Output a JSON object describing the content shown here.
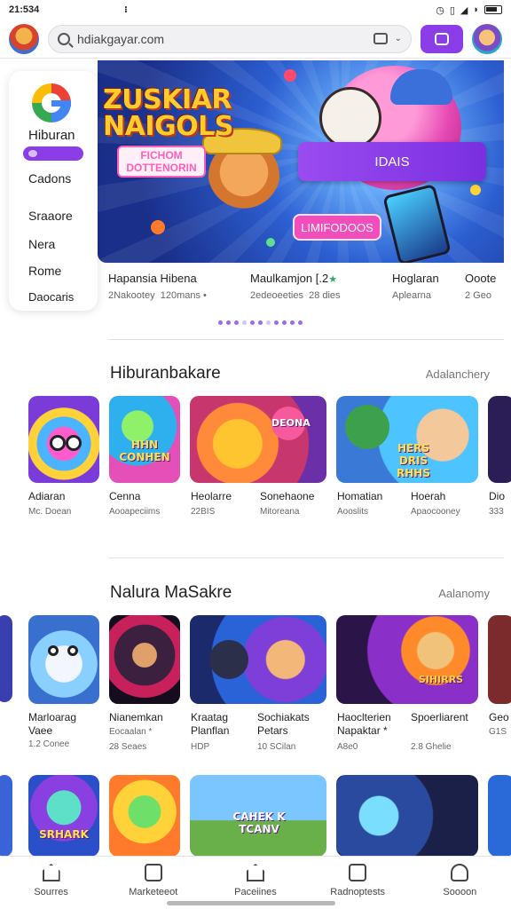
{
  "status_bar": {
    "time": "21:534",
    "mid": "⁝",
    "icons": [
      "alarm-icon",
      "vibrate-icon",
      "signal-icon",
      "wifi-icon",
      "battery-icon"
    ]
  },
  "top_bar": {
    "search_value": "hdiakgayar.com",
    "search_icon": "search-icon",
    "tab_icon": "tab-switcher-icon",
    "menu_chevron": "⌄"
  },
  "sidebar": {
    "items": [
      "Hiburan",
      "Cadons",
      "Sraaore",
      "Nera",
      "Rome",
      "Daocaris"
    ]
  },
  "hero": {
    "title_line1": "ZUSKIAR",
    "title_line2": "NAIGOLS",
    "subtitle": "FICHOM DOTTENORIN",
    "cta_primary": "IDAIS",
    "cta_secondary": "LIMIFODOOS"
  },
  "featured": [
    {
      "name": "Hapansia Hibena",
      "sub1": "2Nakootey",
      "sub2": "120mans",
      "extra": "•"
    },
    {
      "name": "Maulkamjon",
      "badge": "[.2",
      "star": "★",
      "sub1": "2edeoeeties",
      "sub2": "28 dies"
    },
    {
      "name": "Hoglaran",
      "sub1": "Aplearna"
    },
    {
      "name": "Ooote",
      "sub1": "2 Geo"
    }
  ],
  "carousel": {
    "dots_total": 11,
    "active_dot": 5
  },
  "section1": {
    "title": "Hiburanbakare",
    "action": "Adalanchery",
    "tiles": [
      {
        "name": "Adiaran",
        "sub": "Mc. Doean"
      },
      {
        "name": "Cenna",
        "sub": "Aooapeciims",
        "art_text": "HHN CONHEN"
      },
      {
        "name": "Heolarre",
        "sub": "22BIS"
      },
      {
        "name": "Sonehaone",
        "sub": "Mitoreana",
        "art_text": "DEONA"
      },
      {
        "name": "Homatian",
        "sub": "Aooslits"
      },
      {
        "name": "Hoerah",
        "sub": "Apaocooney",
        "art_text": "HERS DRIS RHHS"
      },
      {
        "name": "Dio",
        "sub": "333"
      }
    ]
  },
  "section2": {
    "title": "Nalura MaSakre",
    "action": "Aalanomy",
    "tiles": [
      {
        "name": "Marloarag Vaee",
        "sub": "1.2 Conee"
      },
      {
        "name": "Nianemkan",
        "sub": "Eocaalan",
        "extra": "*",
        "sub2": "28 Seaes"
      },
      {
        "name": "Kraatag Planflan",
        "sub": "HDP"
      },
      {
        "name": "Sochiakats Petars",
        "sub": "10 SCilan"
      },
      {
        "name": "Haoclterien Napaktar",
        "extra": "*",
        "sub": "A8e0"
      },
      {
        "name": "Spoerliarent",
        "sub": "2.8 Ghelie",
        "art_text": "SIHIRRS"
      },
      {
        "name": "Geo",
        "sub": "G1S"
      }
    ]
  },
  "section3": {
    "tiles": [
      {
        "art_text": "SRHARK"
      },
      {
        "art_text": ""
      },
      {
        "art_text": "CAHEK K TCANV"
      },
      {
        "art_text": ""
      }
    ]
  },
  "bottom_nav": [
    {
      "label": "Sourres",
      "icon": "home-icon"
    },
    {
      "label": "Marketeeot",
      "icon": "calendar-icon"
    },
    {
      "label": "Paceiines",
      "icon": "house-icon"
    },
    {
      "label": "Radnoptests",
      "icon": "clipboard-icon"
    },
    {
      "label": "Soooon",
      "icon": "profile-icon"
    }
  ],
  "colors": {
    "accent": "#8b3ee8",
    "hero_bg": "#2c5fd1",
    "cta_pink": "#f24dbb",
    "rating_green": "#2ea86b"
  }
}
